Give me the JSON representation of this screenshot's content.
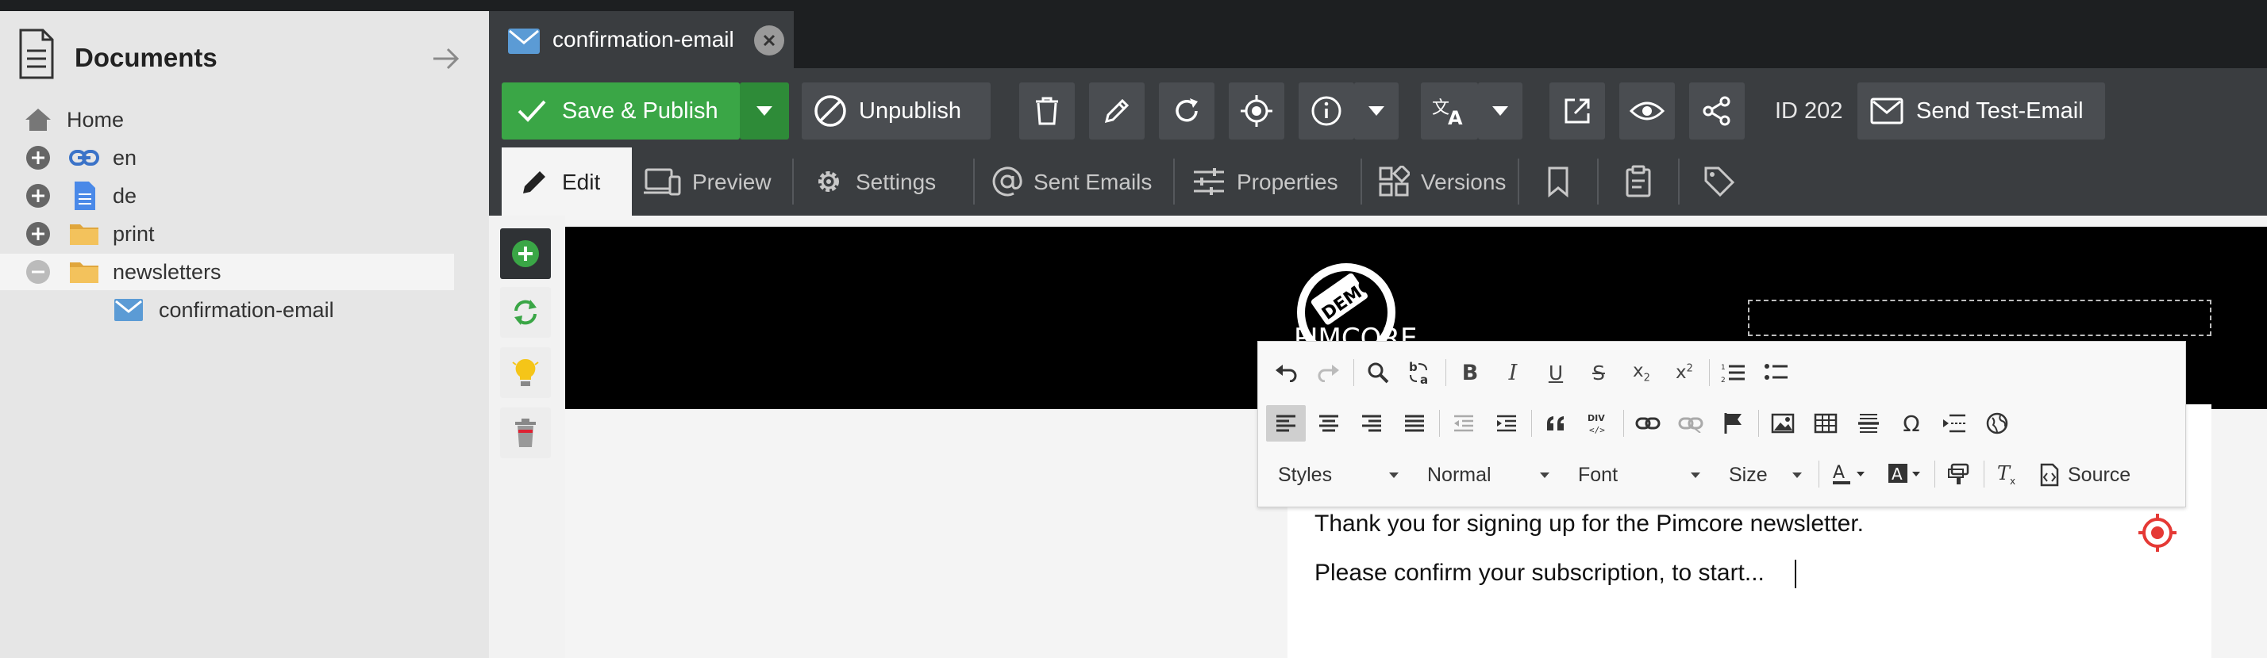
{
  "tree": {
    "title": "Documents",
    "items": [
      {
        "label": "Home"
      },
      {
        "label": "en"
      },
      {
        "label": "de"
      },
      {
        "label": "print"
      },
      {
        "label": "newsletters"
      },
      {
        "label": "confirmation-email"
      }
    ]
  },
  "tab": {
    "label": "confirmation-email"
  },
  "toolbar": {
    "save_publish": "Save & Publish",
    "unpublish": "Unpublish",
    "id_label": "ID 202",
    "send_test": "Send Test-Email"
  },
  "subtabs": {
    "edit": "Edit",
    "preview": "Preview",
    "settings": "Settings",
    "sent_emails": "Sent Emails",
    "properties": "Properties",
    "versions": "Versions"
  },
  "editor": {
    "styles": "Styles",
    "format": "Normal",
    "font": "Font",
    "size": "Size",
    "source": "Source"
  },
  "email": {
    "logo_text": "PIMCORE",
    "logo_badge": "DEMO",
    "line1": "Thank you for signing up for the Pimcore newsletter.",
    "line2": "Please confirm your subscription, to start..."
  },
  "colors": {
    "accent_green": "#3aa646",
    "toolbar_bg": "#3a3d40",
    "tabstrip_bg": "#1d1f21",
    "email_icon_blue": "#5b9bd5",
    "folder_yellow": "#f3c25c",
    "target_red": "#e53935"
  }
}
